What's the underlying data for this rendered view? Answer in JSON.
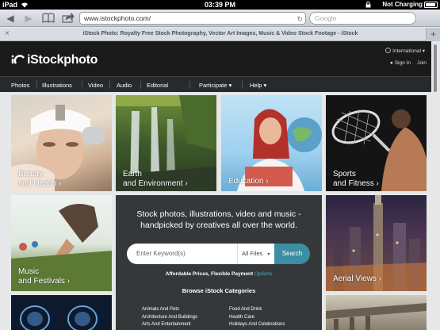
{
  "status_bar": {
    "device": "iPad",
    "time": "03:39 PM",
    "battery_text": "Not Charging"
  },
  "browser": {
    "url": "www.istockphoto.com/",
    "search_placeholder": "Google",
    "tab_title": "iStock Photo: Royalty Free Stock Photography, Vector Art Images, Music & Video Stock Footage - iStock"
  },
  "site": {
    "logo": "iStockphoto",
    "region": "International",
    "sign_in": "Sign In",
    "join": "Join",
    "nav": [
      "Photos",
      "Illustrations",
      "Video",
      "Audio",
      "Editorial",
      "Participate",
      "Help"
    ]
  },
  "tiles": {
    "beauty": {
      "line1": "Beauty",
      "line2": "and Health"
    },
    "earth": {
      "line1": "Earth",
      "line2": "and Environment"
    },
    "education": {
      "line1": "Education"
    },
    "sports": {
      "line1": "Sports",
      "line2": "and Fitness"
    },
    "music": {
      "line1": "Music",
      "line2": "and Festivals"
    },
    "aerial": {
      "line1": "Aerial Views"
    }
  },
  "panel": {
    "headline1": "Stock photos, illustrations, video and music -",
    "headline2": "handpicked by creatives all over the world.",
    "placeholder": "Enter Keyword(s)",
    "filter": "All Files",
    "search_btn": "Search",
    "affordable": "Affordable Prices, Flexible Payment",
    "options": "Options",
    "browse_title": "Browse iStock Categories",
    "categories": [
      "Animals And Pets",
      "Architecture And Buildings",
      "Arts And Entertainment",
      "Food And Drink",
      "Health Care",
      "Holidays And Celebrations"
    ]
  }
}
